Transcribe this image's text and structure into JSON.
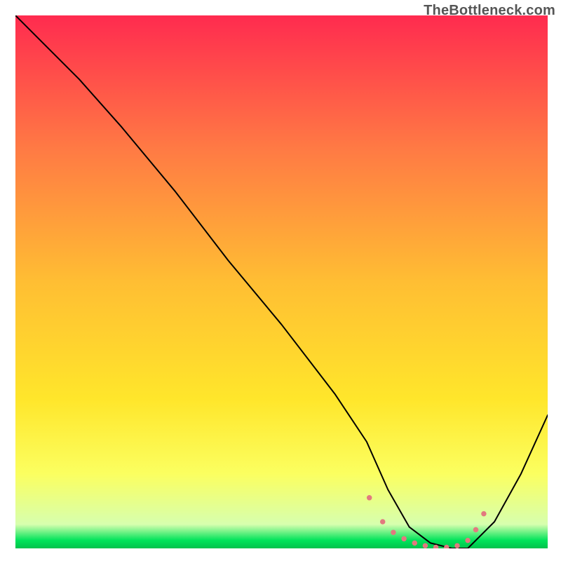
{
  "watermark": "TheBottleneck.com",
  "chart_data": {
    "type": "line",
    "title": "",
    "xlabel": "",
    "ylabel": "",
    "xlim": [
      0,
      100
    ],
    "ylim": [
      0,
      100
    ],
    "grid": false,
    "legend": false,
    "gradient_stops": [
      {
        "offset": 0.0,
        "color": "#ff2b4f"
      },
      {
        "offset": 0.25,
        "color": "#ff7a44"
      },
      {
        "offset": 0.5,
        "color": "#ffbe33"
      },
      {
        "offset": 0.72,
        "color": "#ffe62b"
      },
      {
        "offset": 0.86,
        "color": "#fbff60"
      },
      {
        "offset": 0.955,
        "color": "#d7ffae"
      },
      {
        "offset": 0.985,
        "color": "#00e35a"
      },
      {
        "offset": 1.0,
        "color": "#00c24c"
      }
    ],
    "series": [
      {
        "name": "bottleneck-curve",
        "stroke": "#000000",
        "stroke_width": 2,
        "x": [
          0,
          6,
          12,
          20,
          30,
          40,
          50,
          60,
          66,
          70,
          74,
          78,
          82,
          85,
          90,
          95,
          100
        ],
        "y": [
          100,
          94,
          88,
          79,
          67,
          54,
          42,
          29,
          20,
          11,
          4,
          1,
          0,
          0,
          5,
          14,
          25
        ]
      },
      {
        "name": "optimal-zone-marker",
        "stroke": "#e2797f",
        "stroke_width": 6,
        "dash": true,
        "x": [
          66.5,
          69,
          71,
          73,
          75,
          77,
          79,
          81,
          83,
          85,
          86.5,
          88
        ],
        "y": [
          9.5,
          5,
          3,
          1.8,
          1,
          0.5,
          0.2,
          0.2,
          0.5,
          1.5,
          3.5,
          6.5
        ]
      }
    ]
  }
}
